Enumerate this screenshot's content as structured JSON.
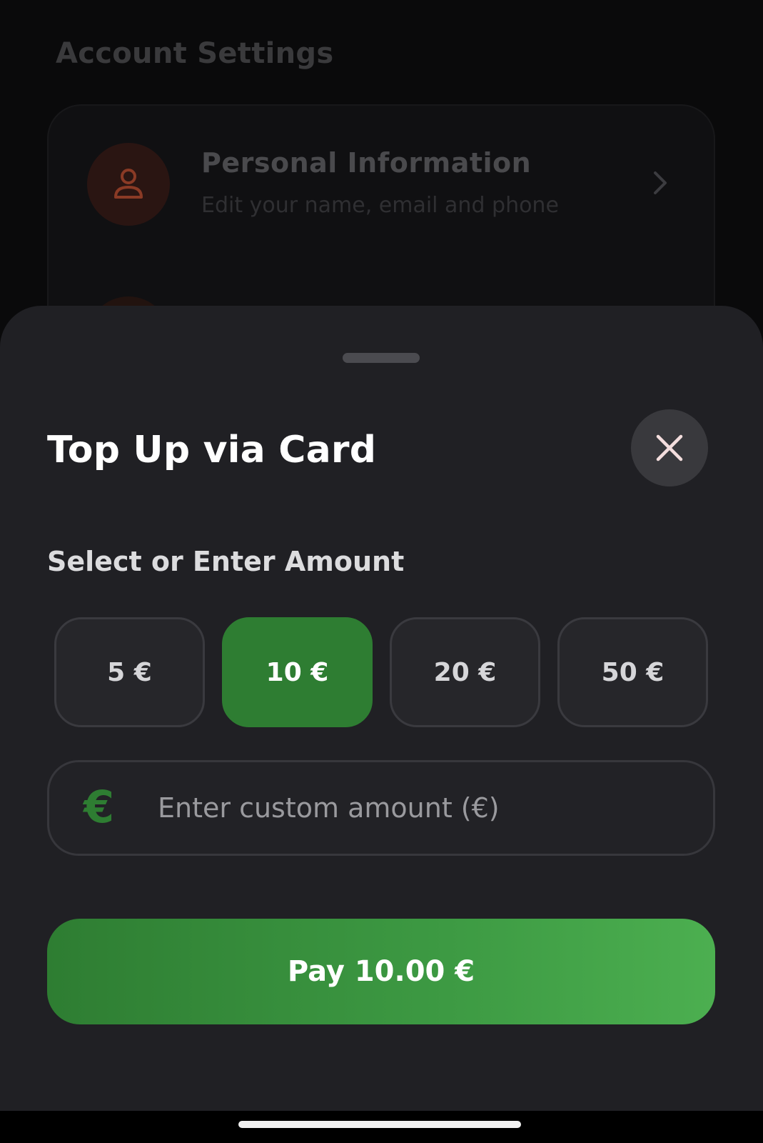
{
  "background": {
    "title": "Account Settings",
    "item": {
      "title": "Personal Information",
      "subtitle": "Edit your name, email and phone",
      "icon": "person-icon"
    }
  },
  "sheet": {
    "title": "Top Up via Card",
    "close_icon": "close-icon",
    "section_label": "Select or Enter Amount",
    "amounts": [
      {
        "label": "5 €",
        "selected": false
      },
      {
        "label": "10 €",
        "selected": true
      },
      {
        "label": "20 €",
        "selected": false
      },
      {
        "label": "50 €",
        "selected": false
      }
    ],
    "custom_amount": {
      "icon_glyph": "€",
      "value": "",
      "placeholder": "Enter custom amount (€)"
    },
    "pay_button_label": "Pay 10.00 €"
  },
  "colors": {
    "accent": "#2e7d32",
    "accent_light": "#4caf50",
    "sheet_bg": "#202024",
    "bg_icon": "#c0492c"
  }
}
